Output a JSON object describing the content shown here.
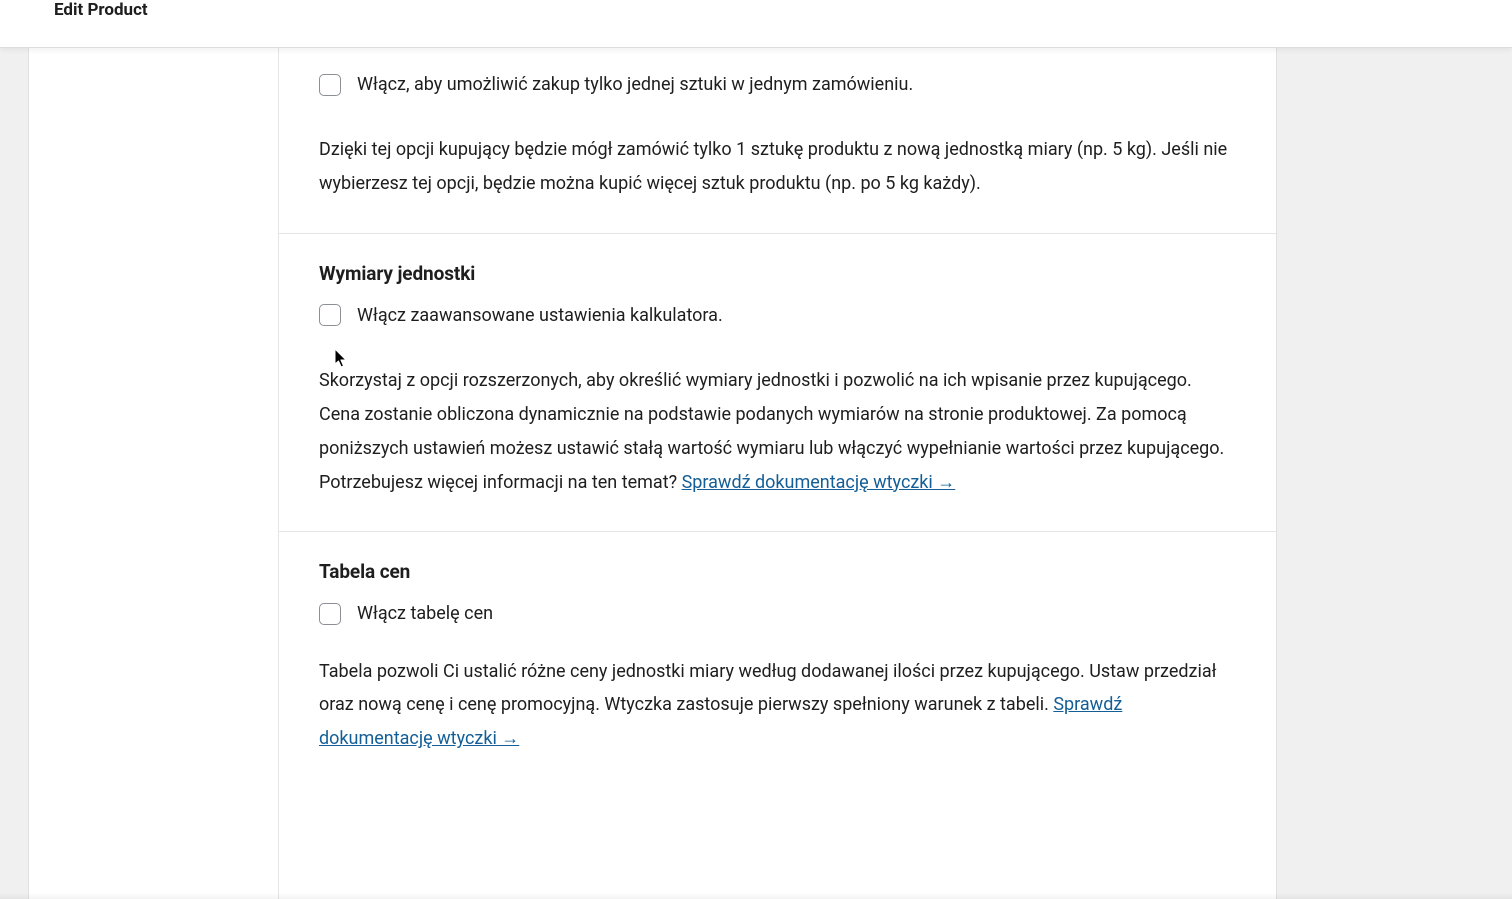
{
  "top_bar": {
    "title": "Edit Product"
  },
  "sections": {
    "single_qty": {
      "checkbox_label": "Włącz, aby umożliwić zakup tylko jednej sztuki w jednym zamówieniu.",
      "description": "Dzięki tej opcji kupujący będzie mógł zamówić tylko 1 sztukę produktu z nową jednostką miary (np. 5 kg). Jeśli nie wybierzesz tej opcji, będzie można kupić więcej sztuk produktu (np. po 5 kg każdy)."
    },
    "unit_dimensions": {
      "heading": "Wymiary jednostki",
      "checkbox_label": "Włącz zaawansowane ustawienia kalkulatora.",
      "description_part1": "Skorzystaj z opcji rozszerzonych, aby określić wymiary jednostki i pozwolić na ich wpisanie przez kupującego. Cena zostanie obliczona dynamicznie na podstawie podanych wymiarów na stronie produktowej. Za pomocą poniższych ustawień możesz ustawić stałą wartość wymiaru lub włączyć wypełnianie wartości przez kupującego. Potrzebujesz więcej informacji na ten temat? ",
      "doc_link_label": "Sprawdź dokumentację wtyczki →"
    },
    "price_table": {
      "heading": "Tabela cen",
      "checkbox_label": "Włącz tabelę cen",
      "description_part1": "Tabela pozwoli Ci ustalić różne ceny jednostki miary według dodawanej ilości przez kupującego. Ustaw przedział oraz nową cenę i cenę promocyjną. Wtyczka zastosuje pierwszy spełniony warunek z tabeli. ",
      "doc_link_label": "Sprawdź dokumentację wtyczki →"
    }
  },
  "colors": {
    "link": "#135e96",
    "text": "#1e1e1e",
    "border": "#e5e5e5",
    "page_bg": "#f0f0f1"
  }
}
